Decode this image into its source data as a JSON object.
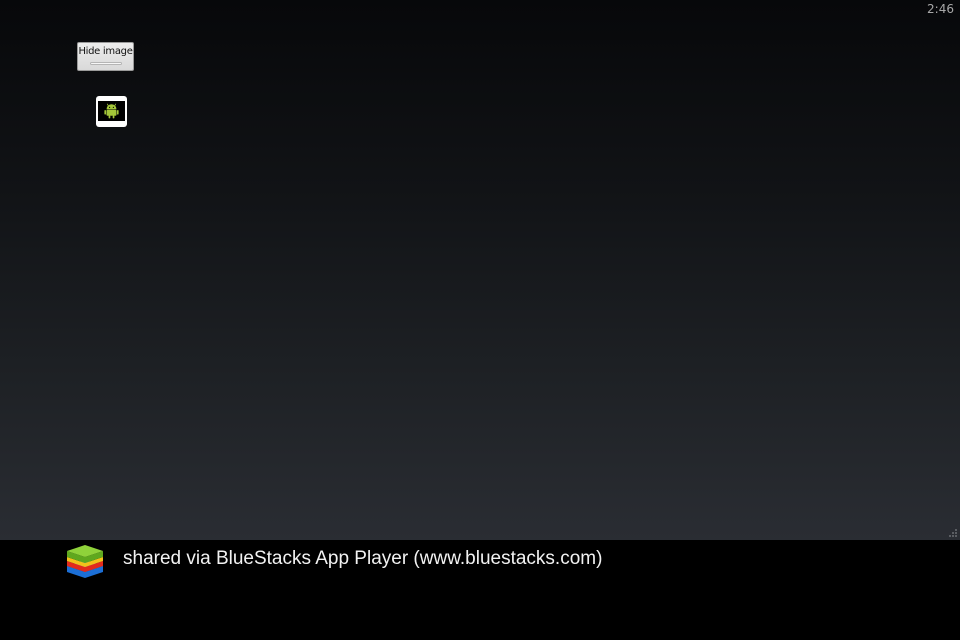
{
  "status_bar": {
    "clock": "2:46"
  },
  "main": {
    "hide_image_label": "Hide image"
  },
  "icons": {
    "thumbnail": "android-icon",
    "footer_logo": "bluestacks-logo",
    "corner": "resize-grip-icon"
  },
  "footer": {
    "text": "shared via BlueStacks App Player (www.bluestacks.com)"
  },
  "colors": {
    "android_green": "#a4c639",
    "background_top": "#07080a",
    "background_bottom": "#2a2d33"
  }
}
